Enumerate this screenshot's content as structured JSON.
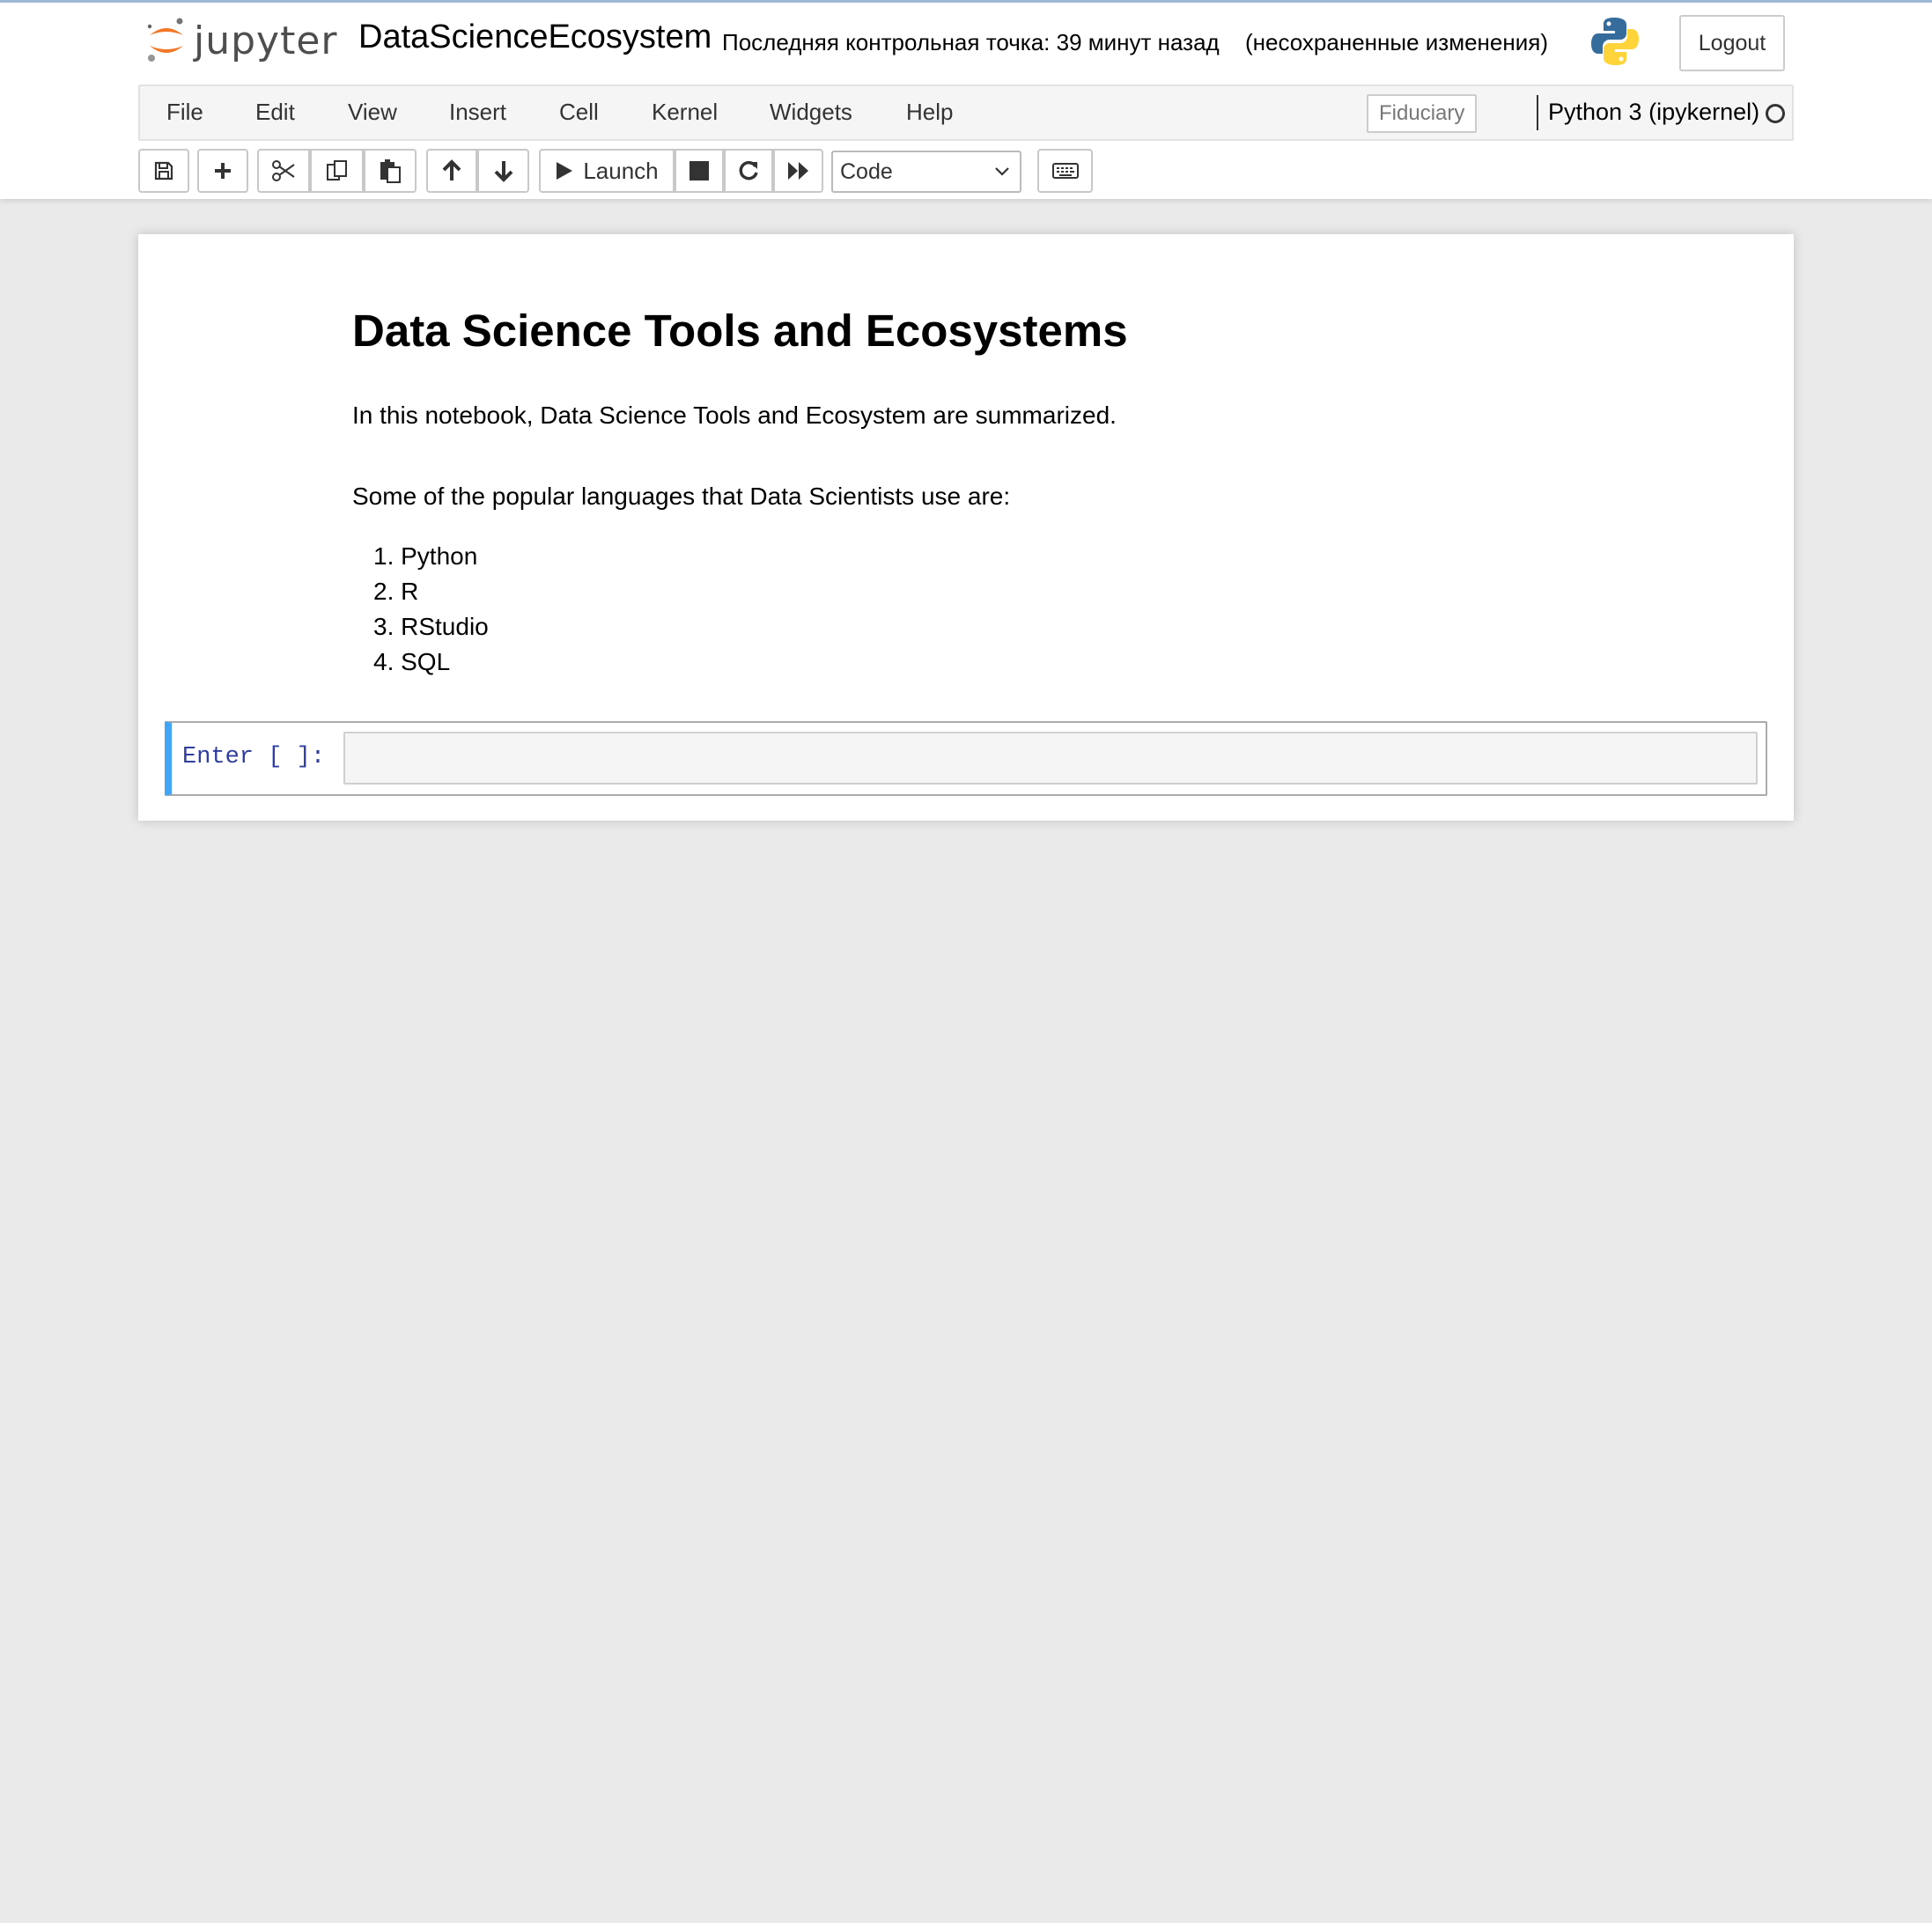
{
  "header": {
    "logo_text": "jupyter",
    "notebook_name": "DataScienceEcosystem",
    "checkpoint": "Последняя контрольная точка: 39 минут назад",
    "autosave_status": "(несохраненные изменения)",
    "logout_label": "Logout"
  },
  "menubar": {
    "items": [
      "File",
      "Edit",
      "View",
      "Insert",
      "Cell",
      "Kernel",
      "Widgets",
      "Help"
    ],
    "trusted_label": "Fiduciary",
    "kernel_name": "Python 3 (ipykernel)"
  },
  "toolbar": {
    "icons": [
      "save-icon",
      "plus-icon",
      "scissors-icon",
      "copy-icon",
      "paste-icon",
      "arrow-up-icon",
      "arrow-down-icon",
      "play-icon",
      "stop-icon",
      "restart-icon",
      "fast-forward-icon",
      "keyboard-icon"
    ],
    "run_label": "Launch",
    "cell_type": "Code"
  },
  "notebook": {
    "title": "Data Science Tools and Ecosystems",
    "intro": "In this notebook, Data Science Tools and Ecosystem are summarized.",
    "languages_intro": "Some of the popular languages that Data Scientists use are:",
    "languages": [
      "1. Python",
      "2. R",
      "3. RStudio",
      "4. SQL"
    ],
    "code_cell": {
      "prompt": "Enter [ ]:",
      "value": ""
    }
  },
  "colors": {
    "accent": "#42a5f5",
    "prompt": "#303f9f",
    "page_bg": "#eaeaea",
    "jupyter_orange": "#f37726"
  }
}
